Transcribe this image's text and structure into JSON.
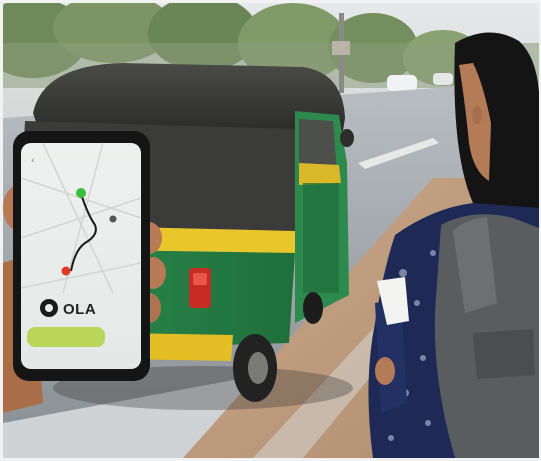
{
  "phone": {
    "brand": "OLA",
    "colors": {
      "route_start": "#3bbf3b",
      "route_end": "#e0392a",
      "button": "#b9d65a"
    }
  },
  "colors": {
    "rickshaw_green": "#2f9a55",
    "rickshaw_yellow": "#e9c62a",
    "rickshaw_canopy": "#3a3a38",
    "backpack": "#5a5d60",
    "kurta": "#1e2a55"
  }
}
